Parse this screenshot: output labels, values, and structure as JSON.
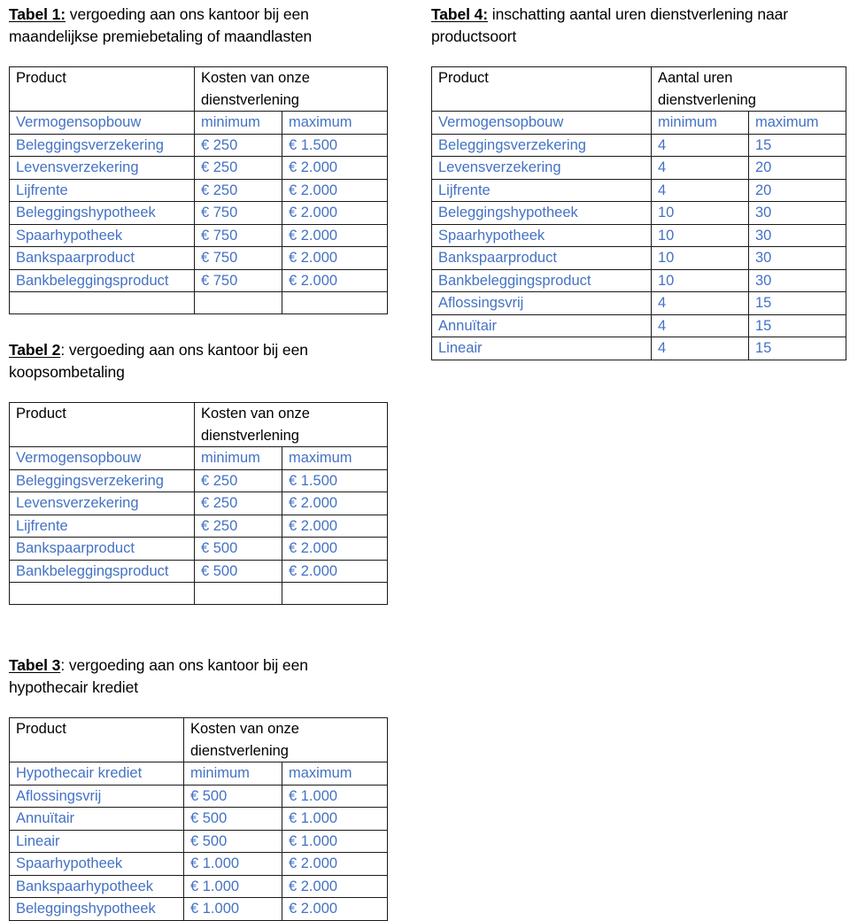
{
  "document": {
    "accent_color": "#4472c4",
    "text_color": "#000000",
    "border_color": "#1a1a1a",
    "background": "#ffffff"
  },
  "table1": {
    "heading_label": "Tabel 1:",
    "heading_rest": " vergoeding aan ons kantoor bij een maandelijkse premiebetaling of maandlasten",
    "header": {
      "col1": "Product",
      "col2_line1": "Kosten van onze",
      "col2_line2": "dienstverlening"
    },
    "subheader": {
      "col1": "Vermogensopbouw",
      "col2": "minimum",
      "col3": "maximum"
    },
    "rows": [
      {
        "product": "Beleggingsverzekering",
        "minimum": "€ 250",
        "maximum": "€ 1.500"
      },
      {
        "product": "Levensverzekering",
        "minimum": "€ 250",
        "maximum": "€ 2.000"
      },
      {
        "product": "Lijfrente",
        "minimum": "€ 250",
        "maximum": "€ 2.000"
      },
      {
        "product": "Beleggingshypotheek",
        "minimum": "€ 750",
        "maximum": "€ 2.000"
      },
      {
        "product": "Spaarhypotheek",
        "minimum": "€ 750",
        "maximum": "€ 2.000"
      },
      {
        "product": "Bankspaarproduct",
        "minimum": "€ 750",
        "maximum": "€ 2.000"
      },
      {
        "product": "Bankbeleggingsproduct",
        "minimum": "€ 750",
        "maximum": "€ 2.000"
      },
      {
        "product": "",
        "minimum": "",
        "maximum": ""
      }
    ]
  },
  "table2": {
    "heading_label": "Tabel 2",
    "heading_rest": ": vergoeding aan ons kantoor bij een koopsombetaling",
    "header": {
      "col1": "Product",
      "col2_line1": "Kosten van onze",
      "col2_line2": "dienstverlening"
    },
    "subheader": {
      "col1": "Vermogensopbouw",
      "col2": "minimum",
      "col3": "maximum"
    },
    "rows": [
      {
        "product": "Beleggingsverzekering",
        "minimum": "€ 250",
        "maximum": "€ 1.500"
      },
      {
        "product": "Levensverzekering",
        "minimum": "€ 250",
        "maximum": "€ 2.000"
      },
      {
        "product": "Lijfrente",
        "minimum": "€ 250",
        "maximum": "€ 2.000"
      },
      {
        "product": "Bankspaarproduct",
        "minimum": "€ 500",
        "maximum": "€ 2.000"
      },
      {
        "product": "Bankbeleggingsproduct",
        "minimum": "€ 500",
        "maximum": "€ 2.000"
      },
      {
        "product": "",
        "minimum": "",
        "maximum": ""
      }
    ]
  },
  "table3": {
    "heading_label": "Tabel 3",
    "heading_rest": ": vergoeding aan ons kantoor bij een hypothecair krediet",
    "header": {
      "col1": "Product",
      "col2_line1": "Kosten van onze",
      "col2_line2": "dienstverlening"
    },
    "subheader": {
      "col1": "Hypothecair krediet",
      "col2": "minimum",
      "col3": "maximum"
    },
    "rows": [
      {
        "product": "Aflossingsvrij",
        "minimum": "€ 500",
        "maximum": "€ 1.000"
      },
      {
        "product": "Annuïtair",
        "minimum": "€ 500",
        "maximum": "€ 1.000"
      },
      {
        "product": "Lineair",
        "minimum": "€ 500",
        "maximum": "€ 1.000"
      },
      {
        "product": "Spaarhypotheek",
        "minimum": "€ 1.000",
        "maximum": "€ 2.000"
      },
      {
        "product": "Bankspaarhypotheek",
        "minimum": "€ 1.000",
        "maximum": "€ 2.000"
      },
      {
        "product": "Beleggingshypotheek",
        "minimum": "€ 1.000",
        "maximum": "€ 2.000"
      }
    ]
  },
  "table4": {
    "heading_label": "Tabel 4:",
    "heading_rest": " inschatting aantal uren dienstverlening naar productsoort",
    "header": {
      "col1": "Product",
      "col2_line1": "Aantal uren",
      "col2_line2": "dienstverlening"
    },
    "subheader": {
      "col1": "Vermogensopbouw",
      "col2": "minimum",
      "col3": "maximum"
    },
    "rows": [
      {
        "product": "Beleggingsverzekering",
        "minimum": "4",
        "maximum": "15"
      },
      {
        "product": "Levensverzekering",
        "minimum": "4",
        "maximum": "20"
      },
      {
        "product": "Lijfrente",
        "minimum": "4",
        "maximum": "20"
      },
      {
        "product": "Beleggingshypotheek",
        "minimum": "10",
        "maximum": "30"
      },
      {
        "product": "Spaarhypotheek",
        "minimum": "10",
        "maximum": "30"
      },
      {
        "product": "Bankspaarproduct",
        "minimum": "10",
        "maximum": "30"
      },
      {
        "product": "Bankbeleggingsproduct",
        "minimum": "10",
        "maximum": "30"
      },
      {
        "product": "Aflossingsvrij",
        "minimum": "4",
        "maximum": "15"
      },
      {
        "product": "Annuïtair",
        "minimum": "4",
        "maximum": "15"
      },
      {
        "product": "Lineair",
        "minimum": "4",
        "maximum": "15"
      }
    ]
  }
}
